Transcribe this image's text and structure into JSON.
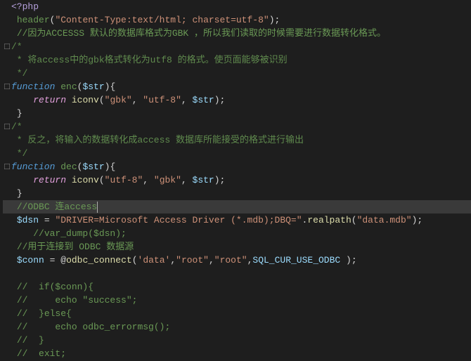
{
  "lines": [
    {
      "fold": "",
      "segments": [
        {
          "cls": "php-tag",
          "text": "<?php"
        }
      ]
    },
    {
      "fold": "",
      "segments": [
        {
          "cls": "white",
          "text": " "
        },
        {
          "cls": "function-name",
          "text": "header"
        },
        {
          "cls": "paren",
          "text": "("
        },
        {
          "cls": "string",
          "text": "\"Content-Type:text/html; charset=utf-8\""
        },
        {
          "cls": "paren",
          "text": ")"
        },
        {
          "cls": "semi",
          "text": ";"
        }
      ]
    },
    {
      "fold": "",
      "segments": [
        {
          "cls": "white",
          "text": " "
        },
        {
          "cls": "comment",
          "text": "//因为ACCESSS 默认的数据库格式为GBK ，所以我们读取的时候需要进行数据转化格式。"
        }
      ]
    },
    {
      "fold": "□",
      "segments": [
        {
          "cls": "comment-block",
          "text": "/*"
        }
      ]
    },
    {
      "fold": "",
      "segments": [
        {
          "cls": "comment-block",
          "text": " * 将access中的gbk格式转化为utf8 的格式。使页面能够被识别"
        }
      ]
    },
    {
      "fold": "",
      "segments": [
        {
          "cls": "comment-block",
          "text": " */"
        }
      ]
    },
    {
      "fold": "□",
      "segments": [
        {
          "cls": "keyword-function",
          "text": "function"
        },
        {
          "cls": "white",
          "text": " "
        },
        {
          "cls": "function-name",
          "text": "enc"
        },
        {
          "cls": "paren",
          "text": "("
        },
        {
          "cls": "variable",
          "text": "$str"
        },
        {
          "cls": "paren",
          "text": ")"
        },
        {
          "cls": "brace",
          "text": "{"
        }
      ]
    },
    {
      "fold": "",
      "segments": [
        {
          "cls": "white",
          "text": "    "
        },
        {
          "cls": "keyword-return",
          "text": "return"
        },
        {
          "cls": "white",
          "text": " "
        },
        {
          "cls": "func-i",
          "text": "iconv"
        },
        {
          "cls": "paren",
          "text": "("
        },
        {
          "cls": "string",
          "text": "\"gbk\""
        },
        {
          "cls": "punct",
          "text": ", "
        },
        {
          "cls": "string",
          "text": "\"utf-8\""
        },
        {
          "cls": "punct",
          "text": ", "
        },
        {
          "cls": "variable",
          "text": "$str"
        },
        {
          "cls": "paren",
          "text": ")"
        },
        {
          "cls": "semi",
          "text": ";"
        }
      ]
    },
    {
      "fold": "",
      "segments": [
        {
          "cls": "white",
          "text": " "
        },
        {
          "cls": "brace",
          "text": "}"
        }
      ]
    },
    {
      "fold": "□",
      "segments": [
        {
          "cls": "comment-block",
          "text": "/*"
        }
      ]
    },
    {
      "fold": "",
      "segments": [
        {
          "cls": "comment-block",
          "text": " * 反之，将输入的数据转化成access 数据库所能接受的格式进行输出"
        }
      ]
    },
    {
      "fold": "",
      "segments": [
        {
          "cls": "comment-block",
          "text": " */"
        }
      ]
    },
    {
      "fold": "□",
      "segments": [
        {
          "cls": "keyword-function",
          "text": "function"
        },
        {
          "cls": "white",
          "text": " "
        },
        {
          "cls": "function-name",
          "text": "dec"
        },
        {
          "cls": "paren",
          "text": "("
        },
        {
          "cls": "variable",
          "text": "$str"
        },
        {
          "cls": "paren",
          "text": ")"
        },
        {
          "cls": "brace",
          "text": "{"
        }
      ]
    },
    {
      "fold": "",
      "segments": [
        {
          "cls": "white",
          "text": "    "
        },
        {
          "cls": "keyword-return",
          "text": "return"
        },
        {
          "cls": "white",
          "text": " "
        },
        {
          "cls": "func-i",
          "text": "iconv"
        },
        {
          "cls": "paren",
          "text": "("
        },
        {
          "cls": "string",
          "text": "\"utf-8\""
        },
        {
          "cls": "punct",
          "text": ", "
        },
        {
          "cls": "string",
          "text": "\"gbk\""
        },
        {
          "cls": "punct",
          "text": ", "
        },
        {
          "cls": "variable",
          "text": "$str"
        },
        {
          "cls": "paren",
          "text": ")"
        },
        {
          "cls": "semi",
          "text": ";"
        }
      ]
    },
    {
      "fold": "",
      "segments": [
        {
          "cls": "white",
          "text": " "
        },
        {
          "cls": "brace",
          "text": "}"
        }
      ]
    },
    {
      "fold": "",
      "highlighted": true,
      "cursor": true,
      "segments": [
        {
          "cls": "white",
          "text": " "
        },
        {
          "cls": "comment",
          "text": "//ODBC 连access"
        }
      ]
    },
    {
      "fold": "",
      "segments": [
        {
          "cls": "white",
          "text": " "
        },
        {
          "cls": "variable",
          "text": "$dsn"
        },
        {
          "cls": "white",
          "text": " "
        },
        {
          "cls": "operator",
          "text": "="
        },
        {
          "cls": "white",
          "text": " "
        },
        {
          "cls": "string",
          "text": "\"DRIVER=Microsoft Access Driver (*.mdb);DBQ=\""
        },
        {
          "cls": "operator",
          "text": "."
        },
        {
          "cls": "func-builtin",
          "text": "realpath"
        },
        {
          "cls": "paren",
          "text": "("
        },
        {
          "cls": "string",
          "text": "\"data.mdb\""
        },
        {
          "cls": "paren",
          "text": ")"
        },
        {
          "cls": "semi",
          "text": ";"
        }
      ]
    },
    {
      "fold": "",
      "segments": [
        {
          "cls": "white",
          "text": "    "
        },
        {
          "cls": "comment",
          "text": "//var_dump($dsn);"
        }
      ]
    },
    {
      "fold": "",
      "segments": [
        {
          "cls": "white",
          "text": " "
        },
        {
          "cls": "comment",
          "text": "//用于连接到 ODBC 数据源"
        }
      ]
    },
    {
      "fold": "",
      "segments": [
        {
          "cls": "white",
          "text": " "
        },
        {
          "cls": "variable",
          "text": "$conn"
        },
        {
          "cls": "white",
          "text": " "
        },
        {
          "cls": "operator",
          "text": "="
        },
        {
          "cls": "white",
          "text": " "
        },
        {
          "cls": "at-symbol",
          "text": "@"
        },
        {
          "cls": "func-builtin",
          "text": "odbc_connect"
        },
        {
          "cls": "paren",
          "text": "("
        },
        {
          "cls": "string",
          "text": "'data'"
        },
        {
          "cls": "punct",
          "text": ","
        },
        {
          "cls": "string",
          "text": "\"root\""
        },
        {
          "cls": "punct",
          "text": ","
        },
        {
          "cls": "string",
          "text": "\"root\""
        },
        {
          "cls": "punct",
          "text": ","
        },
        {
          "cls": "constant",
          "text": "SQL_CUR_USE_ODBC"
        },
        {
          "cls": "white",
          "text": " "
        },
        {
          "cls": "paren",
          "text": ")"
        },
        {
          "cls": "semi",
          "text": ";"
        }
      ]
    },
    {
      "fold": "",
      "segments": [
        {
          "cls": "white",
          "text": " "
        }
      ]
    },
    {
      "fold": "",
      "segments": [
        {
          "cls": "white",
          "text": " "
        },
        {
          "cls": "comment",
          "text": "//  if($conn){"
        }
      ]
    },
    {
      "fold": "",
      "segments": [
        {
          "cls": "white",
          "text": " "
        },
        {
          "cls": "comment",
          "text": "//     echo \"success\";"
        }
      ]
    },
    {
      "fold": "",
      "segments": [
        {
          "cls": "white",
          "text": " "
        },
        {
          "cls": "comment",
          "text": "//  }else{"
        }
      ]
    },
    {
      "fold": "",
      "segments": [
        {
          "cls": "white",
          "text": " "
        },
        {
          "cls": "comment",
          "text": "//     echo odbc_errormsg();"
        }
      ]
    },
    {
      "fold": "",
      "segments": [
        {
          "cls": "white",
          "text": " "
        },
        {
          "cls": "comment",
          "text": "//  }"
        }
      ]
    },
    {
      "fold": "",
      "segments": [
        {
          "cls": "white",
          "text": " "
        },
        {
          "cls": "comment",
          "text": "//  exit;"
        }
      ]
    }
  ]
}
